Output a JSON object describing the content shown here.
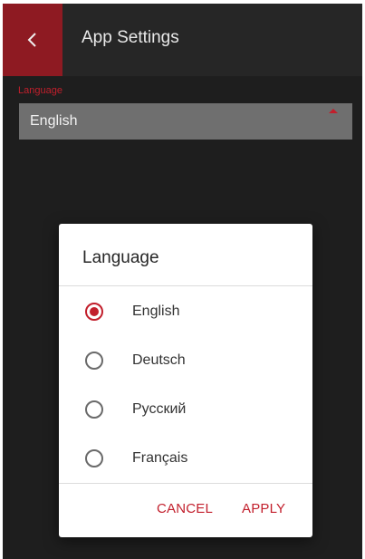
{
  "header": {
    "title": "App Settings",
    "back_icon": "chevron-left-icon"
  },
  "language_field": {
    "label": "Language",
    "value": "English",
    "caret_icon": "caret-up-icon"
  },
  "dialog": {
    "title": "Language",
    "options": [
      {
        "label": "English",
        "selected": true
      },
      {
        "label": "Deutsch",
        "selected": false
      },
      {
        "label": "Русский",
        "selected": false
      },
      {
        "label": "Français",
        "selected": false
      }
    ],
    "cancel_label": "CANCEL",
    "apply_label": "APPLY"
  },
  "colors": {
    "accent": "#c21f2c",
    "back_button": "#8e1a22",
    "background": "#1e1e1e",
    "header": "#262626",
    "select_bg": "#6f6f6f"
  }
}
